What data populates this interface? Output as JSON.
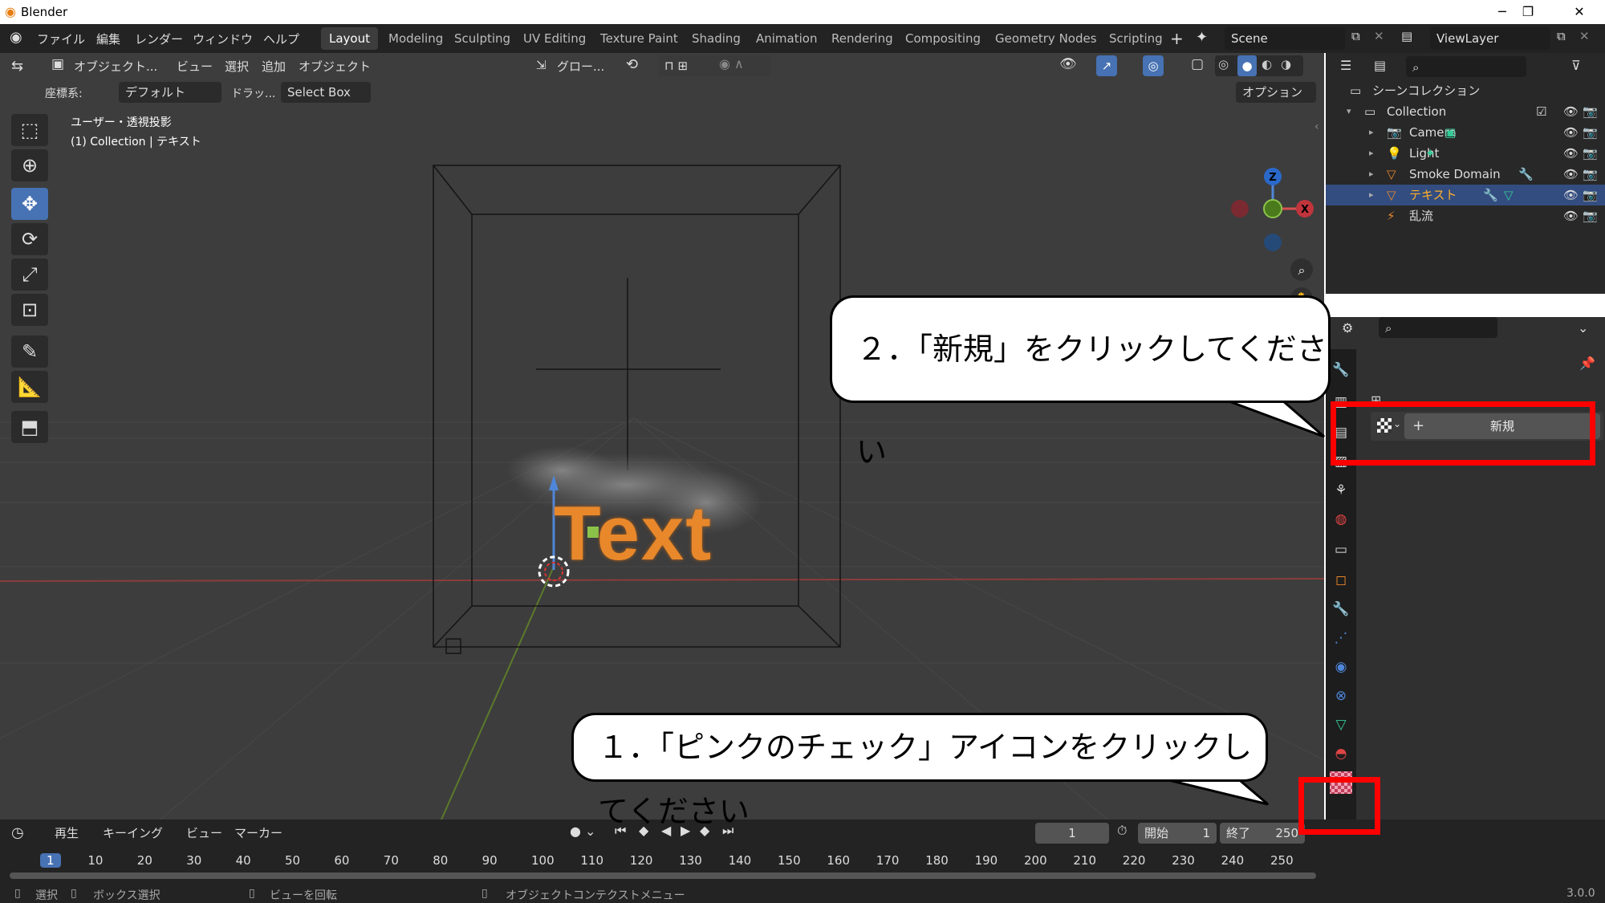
{
  "window": {
    "title": "Blender",
    "minimize": "─",
    "maximize": "❐",
    "close": "✕"
  },
  "menu": {
    "file": "ファイル",
    "edit": "編集",
    "render": "レンダー",
    "window": "ウィンドウ",
    "help": "ヘルプ"
  },
  "workspaces": [
    "Layout",
    "Modeling",
    "Sculpting",
    "UV Editing",
    "Texture Paint",
    "Shading",
    "Animation",
    "Rendering",
    "Compositing",
    "Geometry Nodes",
    "Scripting"
  ],
  "active_workspace": "Layout",
  "add_workspace": "+",
  "scene": {
    "label": "Scene",
    "viewlayer": "ViewLayer"
  },
  "viewport_header": {
    "mode": "オブジェクト...",
    "view": "ビュー",
    "select": "選択",
    "add": "追加",
    "object": "オブジェクト",
    "transform": "グロー...",
    "coord_label": "座標系:",
    "coord_value": "デフォルト",
    "drag_label": "ドラッ...",
    "drag_value": "Select Box",
    "options": "オプション"
  },
  "viewport_info": {
    "line1": "ユーザー・透視投影",
    "line2": "(1) Collection | テキスト"
  },
  "gizmo": {
    "z": "Z",
    "x": "X"
  },
  "scene_text": "Text",
  "callouts": {
    "step2": "２．「新規」をクリックしてください",
    "step1": "１．「ピンクのチェック」アイコンをクリックしてください"
  },
  "outliner": {
    "scene_collection": "シーンコレクション",
    "items": [
      {
        "label": "Collection",
        "icon": "collection-icon"
      },
      {
        "label": "Camera",
        "icon": "camera-icon"
      },
      {
        "label": "Light",
        "icon": "light-icon"
      },
      {
        "label": "Smoke Domain",
        "icon": "mesh-icon"
      },
      {
        "label": "テキスト",
        "icon": "text-icon"
      },
      {
        "label": "乱流",
        "icon": "force-field-icon"
      }
    ]
  },
  "properties": {
    "new_button": "新規",
    "texture_icon": "checker-texture-icon"
  },
  "timeline": {
    "playback": "再生",
    "keying": "キーイング",
    "view": "ビュー",
    "marker": "マーカー",
    "current_frame": "1",
    "start_label": "開始",
    "start_value": "1",
    "end_label": "終了",
    "end_value": "250",
    "frames": [
      "1",
      "10",
      "20",
      "30",
      "40",
      "50",
      "60",
      "70",
      "80",
      "90",
      "100",
      "110",
      "120",
      "130",
      "140",
      "150",
      "160",
      "170",
      "180",
      "190",
      "200",
      "210",
      "220",
      "230",
      "240",
      "250"
    ]
  },
  "statusbar": {
    "select": "選択",
    "box_select": "ボックス選択",
    "rotate_view": "ビューを回転",
    "context_menu": "オブジェクトコンテクストメニュー",
    "version": "3.0.0"
  },
  "colors": {
    "accent_blue": "#4772b3",
    "highlight_red": "#ff0000",
    "object_orange": "#e8882b"
  }
}
